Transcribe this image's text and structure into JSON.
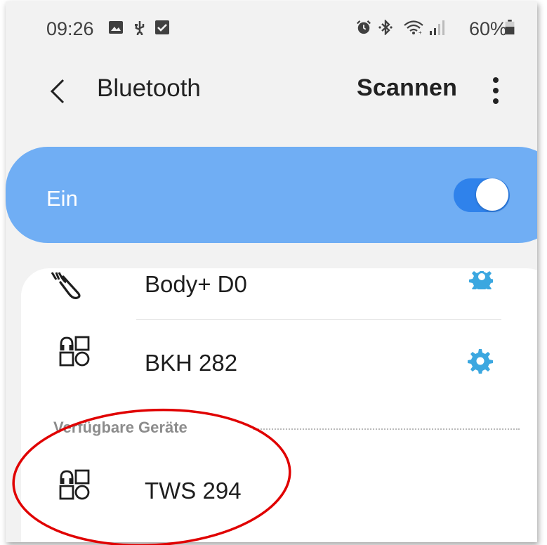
{
  "status_bar": {
    "time": "09:26",
    "battery_percent": "60%",
    "left_icons": [
      "image-icon",
      "usb-icon",
      "check-box-icon"
    ],
    "right_icons": [
      "alarm-icon",
      "bluetooth-icon",
      "wifi-icon",
      "signal-icon",
      "battery-icon"
    ]
  },
  "header": {
    "title": "Bluetooth",
    "scan_label": "Scannen",
    "back_icon": "back-chevron-icon",
    "more_icon": "more-vert-icon"
  },
  "toggle": {
    "label": "Ein",
    "state": "on",
    "accent_color": "#70aef4"
  },
  "paired_devices": [
    {
      "name": "Body+ D0",
      "icon": "scale-wave-icon"
    },
    {
      "name": "BKH 282",
      "icon": "headset-shapes-icon"
    }
  ],
  "available_section": {
    "title": "Verfügbare Geräte",
    "devices": [
      {
        "name": "TWS 294",
        "icon": "headset-shapes-icon"
      }
    ]
  },
  "colors": {
    "gear": "#3ba7e0",
    "annotation": "#e00000"
  }
}
